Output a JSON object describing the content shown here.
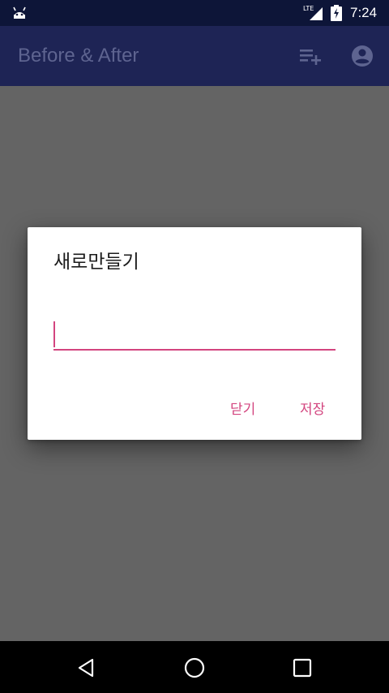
{
  "status_bar": {
    "time": "7:24",
    "network_label": "LTE",
    "icons": [
      "android-icon",
      "lte-signal-icon",
      "battery-charging-icon"
    ]
  },
  "app_bar": {
    "title": "Before & After",
    "actions": [
      "playlist-add-icon",
      "account-circle-icon"
    ]
  },
  "dialog": {
    "title": "새로만들기",
    "input_value": "",
    "buttons": {
      "close": "닫기",
      "save": "저장"
    },
    "accent_color": "#d3457f"
  },
  "nav_bar": {
    "buttons": [
      "back-icon",
      "home-icon",
      "recents-icon"
    ]
  },
  "colors": {
    "status_bar": "#0d1538",
    "app_bar": "#1e2455",
    "scrim": "#646464"
  }
}
